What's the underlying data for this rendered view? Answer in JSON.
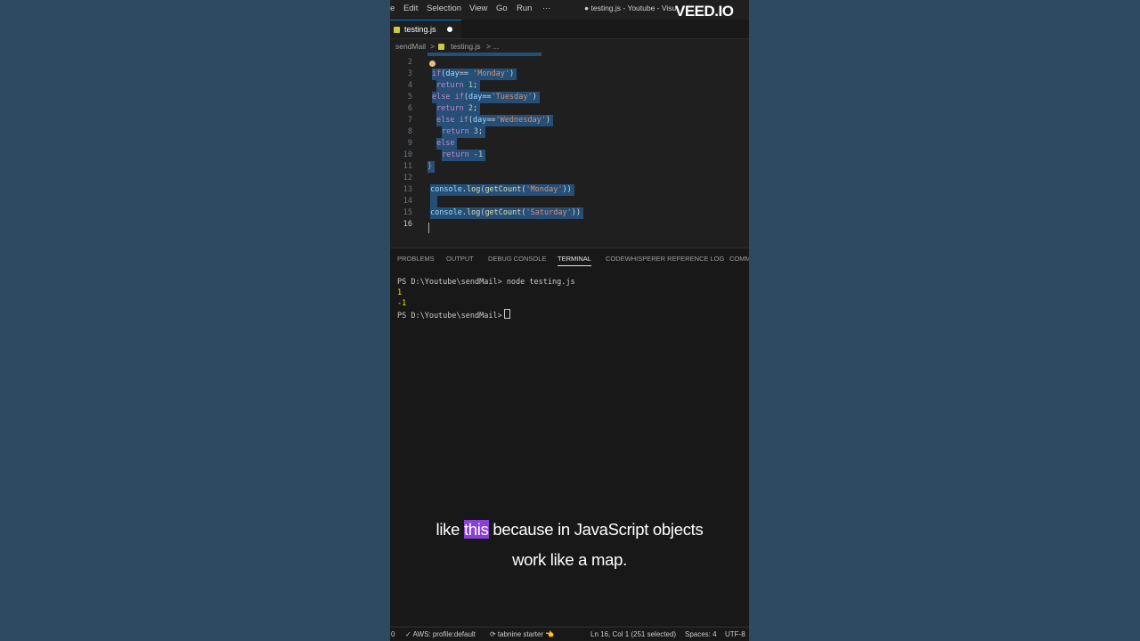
{
  "menubar": {
    "items": [
      "e",
      "Edit",
      "Selection",
      "View",
      "Go",
      "Run",
      "···"
    ],
    "window_title": "● testing.js - Youtube - Visu"
  },
  "watermark": "VEED.IO",
  "tab": {
    "label": "testing.js",
    "modified": true
  },
  "breadcrumb": {
    "folder": "sendMail",
    "sep1": ">",
    "file": "testing.js",
    "sep2": "> ..."
  },
  "editor": {
    "language": "javascript",
    "lines": [
      {
        "num": "2",
        "text": ""
      },
      {
        "num": "3",
        "text": "  if(day== 'Monday')"
      },
      {
        "num": "4",
        "text": "   return 1;"
      },
      {
        "num": "5",
        "text": "  else if(day=='Tuesday')"
      },
      {
        "num": "6",
        "text": "   return 2;"
      },
      {
        "num": "7",
        "text": "   else if(day=='Wednesday')"
      },
      {
        "num": "8",
        "text": "    return 3;"
      },
      {
        "num": "9",
        "text": "   else"
      },
      {
        "num": "10",
        "text": "    return -1"
      },
      {
        "num": "11",
        "text": "}"
      },
      {
        "num": "12",
        "text": ""
      },
      {
        "num": "13",
        "text": " console.log(getCount('Monday'))"
      },
      {
        "num": "14",
        "text": ""
      },
      {
        "num": "15",
        "text": " console.log(getCount('Saturday'))"
      },
      {
        "num": "16",
        "text": ""
      }
    ]
  },
  "panel": {
    "tabs": [
      "PROBLEMS",
      "OUTPUT",
      "DEBUG CONSOLE",
      "TERMINAL",
      "CODEWHISPERER REFERENCE LOG",
      "COMM"
    ],
    "active_tab": "TERMINAL",
    "terminal": {
      "prompt1": "PS D:\\Youtube\\sendMail> node testing.js",
      "out1": "1",
      "out2": "-1",
      "prompt2": "PS D:\\Youtube\\sendMail>"
    }
  },
  "statusbar": {
    "left0": "0",
    "aws": "✓ AWS: profile:default",
    "tabnine": "⟳ tabnine starter 👈",
    "position": "Ln 16, Col 1 (251 selected)",
    "spaces": "Spaces: 4",
    "encoding": "UTF-8"
  },
  "caption": {
    "before": "like ",
    "highlight": "this",
    "after": " because in JavaScript objects",
    "line2": "work like a map."
  },
  "colors": {
    "selection": "#264f78",
    "caption_highlight": "#8b3fd9",
    "background": "#2e4a62"
  }
}
